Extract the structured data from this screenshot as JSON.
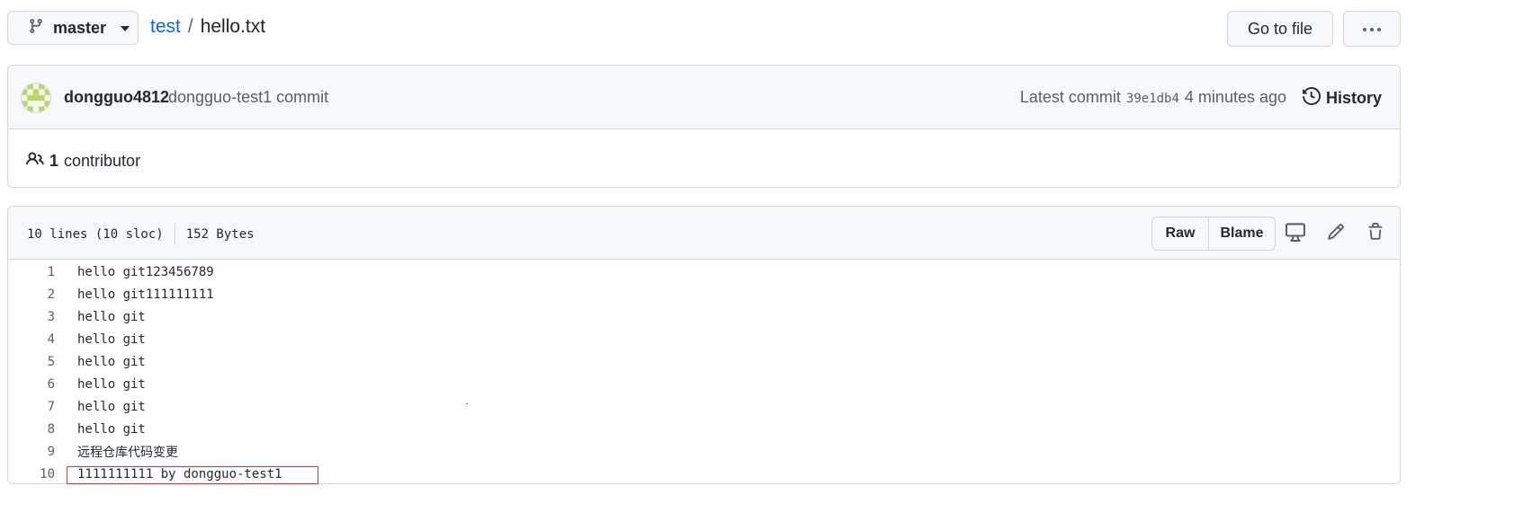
{
  "branch": {
    "name": "master",
    "icon": "git-branch-icon"
  },
  "breadcrumb": {
    "repo": "test",
    "separator": "/",
    "file": "hello.txt"
  },
  "toolbar": {
    "go_to_file": "Go to file",
    "more_icon": "kebab-horizontal-icon"
  },
  "commit": {
    "author": "dongguo4812",
    "message": "dongguo-test1 commit",
    "latest_label": "Latest commit",
    "sha": "39e1db4",
    "time": "4 minutes ago",
    "history_label": "History"
  },
  "contributors": {
    "count": "1",
    "label": "contributor"
  },
  "file": {
    "lines_info": "10 lines (10 sloc)",
    "size": "152 Bytes",
    "raw_label": "Raw",
    "blame_label": "Blame",
    "lines": [
      {
        "n": "1",
        "text": "hello git123456789"
      },
      {
        "n": "2",
        "text": "hello git111111111"
      },
      {
        "n": "3",
        "text": "hello git"
      },
      {
        "n": "4",
        "text": "hello git"
      },
      {
        "n": "5",
        "text": "hello git"
      },
      {
        "n": "6",
        "text": "hello git"
      },
      {
        "n": "7",
        "text": "hello git"
      },
      {
        "n": "8",
        "text": "hello git"
      },
      {
        "n": "9",
        "text": "远程仓库代码变更"
      },
      {
        "n": "10",
        "text": "1111111111 by dongguo-test1"
      }
    ]
  },
  "colors": {
    "link": "#0969da",
    "border": "#d0d7de",
    "header_bg": "#f6f8fa",
    "annotation": "#e5322d"
  }
}
